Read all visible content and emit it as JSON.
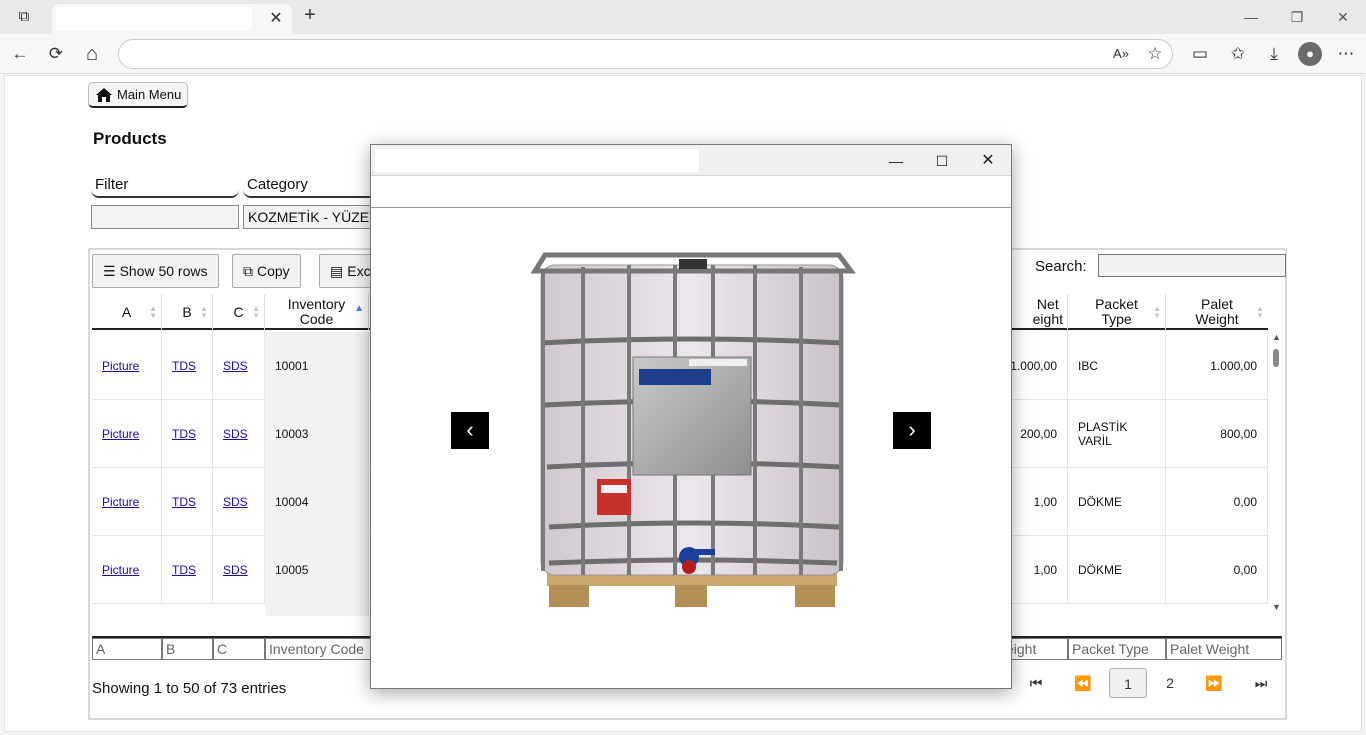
{
  "browser": {
    "tab_close": "✕",
    "new_tab": "+",
    "minimize": "—",
    "restore": "❐",
    "close": "✕",
    "nav": {
      "back": "←",
      "reload": "⟳",
      "home": "⌂",
      "read_aloud": "A»",
      "favorite": "☆",
      "cast": "▭",
      "favorites": "✩",
      "downloads": "⤓",
      "more": "⋯",
      "profile": "●"
    }
  },
  "page": {
    "main_menu_label": "Main Menu",
    "title": "Products",
    "filter_label": "Filter",
    "category_label": "Category",
    "category_value": "KOZMETİK - YÜZEY"
  },
  "table": {
    "buttons": {
      "show_rows": "Show 50 rows",
      "copy": "Copy",
      "excel": "Exc"
    },
    "search_label": "Search:",
    "columns": {
      "a": "A",
      "b": "B",
      "c": "C",
      "inv1": "Inventory",
      "inv2": "Code",
      "net1": "Net",
      "net2": "eight",
      "packet1": "Packet",
      "packet2": "Type",
      "palet1": "Palet",
      "palet2": "Weight"
    },
    "rows": [
      {
        "a": "Picture",
        "b": "TDS",
        "c": "SDS",
        "code": "10001",
        "net": "1.000,00",
        "packet": "IBC",
        "palet": "1.000,00"
      },
      {
        "a": "Picture",
        "b": "TDS",
        "c": "SDS",
        "code": "10003",
        "net": "200,00",
        "packet": "PLASTİK VARİL",
        "palet": "800,00"
      },
      {
        "a": "Picture",
        "b": "TDS",
        "c": "SDS",
        "code": "10004",
        "net": "1,00",
        "packet": "DÖKME",
        "palet": "0,00"
      },
      {
        "a": "Picture",
        "b": "TDS",
        "c": "SDS",
        "code": "10005",
        "net": "1,00",
        "packet": "DÖKME",
        "palet": "0,00"
      }
    ],
    "footer": {
      "a": "A",
      "b": "B",
      "c": "C",
      "inv": "Inventory Code",
      "net": "eight",
      "packet": "Packet Type",
      "palet": "Palet Weight"
    },
    "info": "Showing 1 to 50 of 73 entries",
    "pagination": {
      "first": "⏮",
      "prev": "⏪",
      "current": "1",
      "page2": "2",
      "next": "⏩",
      "last": "⏭"
    }
  },
  "modal": {
    "minimize": "—",
    "maximize": "☐",
    "close": "✕",
    "prev": "‹",
    "next": "›"
  }
}
